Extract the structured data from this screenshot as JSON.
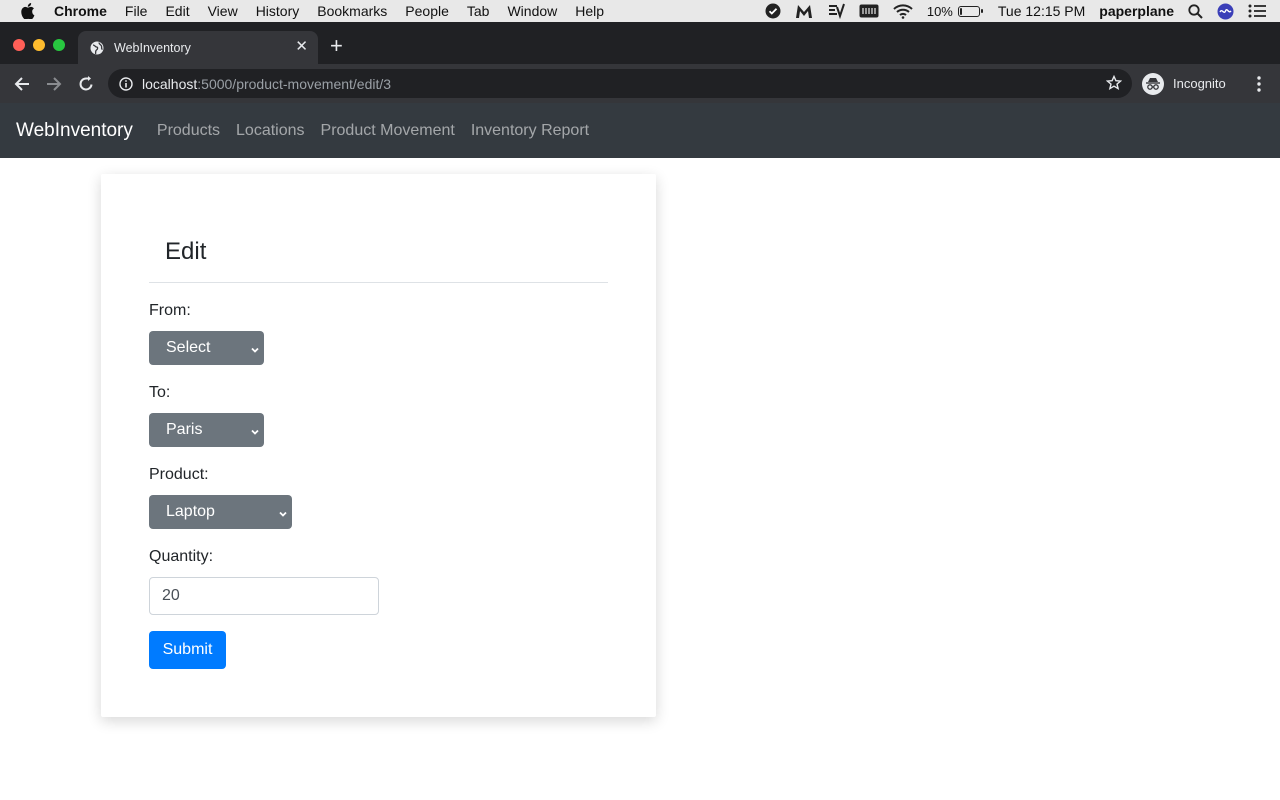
{
  "menubar": {
    "app_name": "Chrome",
    "items": [
      "File",
      "Edit",
      "View",
      "History",
      "Bookmarks",
      "People",
      "Tab",
      "Window",
      "Help"
    ],
    "battery_percent": "10%",
    "battery_level": 0.1,
    "clock": "Tue 12:15 PM",
    "user": "paperplane"
  },
  "browser": {
    "tab_title": "WebInventory",
    "url_host": "localhost",
    "url_path": ":5000/product-movement/edit/3",
    "incognito_label": "Incognito"
  },
  "appnav": {
    "brand": "WebInventory",
    "links": [
      "Products",
      "Locations",
      "Product Movement",
      "Inventory Report"
    ]
  },
  "form": {
    "title": "Edit",
    "from_label": "From:",
    "from_value": "Select",
    "to_label": "To:",
    "to_value": "Paris",
    "product_label": "Product:",
    "product_value": "Laptop",
    "quantity_label": "Quantity:",
    "quantity_value": "20",
    "submit_label": "Submit"
  },
  "colors": {
    "navbar_bg": "#343a40",
    "select_bg": "#6c757d",
    "primary": "#007bff"
  }
}
